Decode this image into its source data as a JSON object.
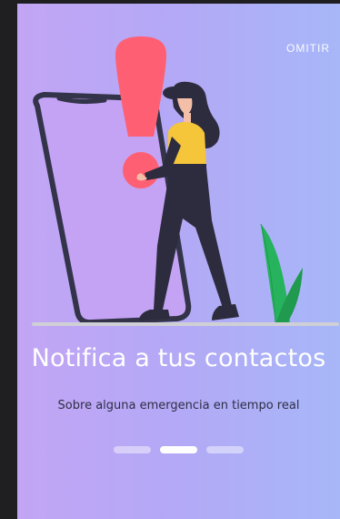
{
  "onboarding": {
    "skip_label": "OMITIR",
    "title": "Notifica a tus contactos",
    "subtitle": "Sobre alguna emergencia en tiempo real",
    "pagination": {
      "total": 3,
      "active_index": 1
    }
  },
  "colors": {
    "background_gradient_start": "#c2a5f4",
    "background_gradient_end": "#a7b7f8",
    "alert_red": "#ff5f73",
    "shirt_yellow": "#f5c53a",
    "plant_green": "#27b35d",
    "dark_figure": "#2d2c3e"
  },
  "icons": {
    "illustration": "woman-with-phone-and-exclamation"
  }
}
